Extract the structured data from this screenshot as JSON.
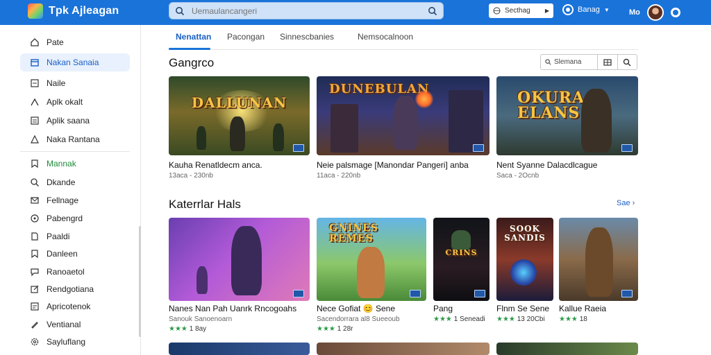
{
  "header": {
    "brand": "Tpk Ajleagan",
    "search_placeholder": "Uemaulancangeri",
    "language": "Secthag",
    "user_name": "Banag",
    "user_short": "Mo",
    "logo_icon": "app-logo-icon"
  },
  "sidebar": {
    "items": [
      {
        "label": "Pate",
        "icon": "home-icon"
      },
      {
        "label": "Nakan Sanaia",
        "icon": "store-icon"
      },
      {
        "label": "Naile",
        "icon": "document-icon"
      },
      {
        "label": "Aplk okalt",
        "icon": "arrow-up-icon"
      },
      {
        "label": "Aplik saana",
        "icon": "list-icon"
      },
      {
        "label": "Naka Rantana",
        "icon": "triangle-icon"
      },
      {
        "label": "Mannak",
        "icon": "bookmark-icon"
      },
      {
        "label": "Dkande",
        "icon": "search-icon"
      },
      {
        "label": "Fellnage",
        "icon": "mail-icon"
      },
      {
        "label": "Pabengrd",
        "icon": "compass-icon"
      },
      {
        "label": "Paaldi",
        "icon": "file-icon"
      },
      {
        "label": "Danleen",
        "icon": "bookmark-outline-icon"
      },
      {
        "label": "Ranoaetol",
        "icon": "chat-icon"
      },
      {
        "label": "Rendgotiana",
        "icon": "edit-icon"
      },
      {
        "label": "Apricotenok",
        "icon": "clipboard-icon"
      },
      {
        "label": "Ventianal",
        "icon": "pen-icon"
      },
      {
        "label": "Sayluflang",
        "icon": "settings-icon"
      }
    ]
  },
  "tabs": [
    "Nenattan",
    "Pacongan",
    "Sinnescbanies",
    "Nemsocalnoon"
  ],
  "section1": {
    "title": "Gangrco",
    "filter_label": "Slemana",
    "cards": [
      {
        "art_title": "DALLUNAN",
        "title": "Kauha Renatldecm anca.",
        "sub": "13aca - 230nb"
      },
      {
        "art_title": "DUNEBULAN",
        "title": "Neie palsmage [Manondar Pangeri] anba",
        "sub": "11aca - 220nb"
      },
      {
        "art_title": "OKURA ELANS",
        "title": "Nent Syanne Dalacdlcague",
        "sub": "Saca - 2Ocnb"
      }
    ]
  },
  "section2": {
    "title": "Katerrlar Hals",
    "see_all": "Sae",
    "cards": [
      {
        "title": "Nanes Nan Pah Uanrk Rncogoahs",
        "sub": "Sanouk Sanoenoarn",
        "rating": "1 8ay",
        "art_title": ""
      },
      {
        "title": "Nece Gofiat 😊 Sene",
        "sub": "Sacendorrara al8 Sueeoub",
        "rating": "1 28r",
        "art_title": "GNINES REMES"
      },
      {
        "title": "Pang",
        "sub": "",
        "rating": "1 Seneadi",
        "art_title": "CRINS"
      },
      {
        "title": "Flnm Se Sene",
        "sub": "",
        "rating": "13 20Cbi",
        "art_title": "SOOK SANDIS"
      },
      {
        "title": "Kallue Raeia",
        "sub": "",
        "rating": "18",
        "art_title": ""
      }
    ]
  },
  "colors": {
    "accent": "#1a73d9",
    "active_bg": "#e8f1fd",
    "green": "#1f8a3a",
    "star": "#2d9a4a"
  }
}
